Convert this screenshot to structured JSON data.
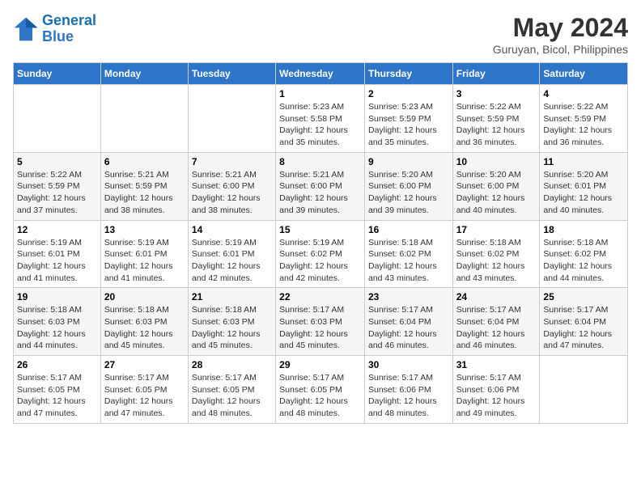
{
  "logo": {
    "line1": "General",
    "line2": "Blue"
  },
  "title": "May 2024",
  "subtitle": "Guruyan, Bicol, Philippines",
  "days_of_week": [
    "Sunday",
    "Monday",
    "Tuesday",
    "Wednesday",
    "Thursday",
    "Friday",
    "Saturday"
  ],
  "weeks": [
    [
      {
        "day": "",
        "sunrise": "",
        "sunset": "",
        "daylight": ""
      },
      {
        "day": "",
        "sunrise": "",
        "sunset": "",
        "daylight": ""
      },
      {
        "day": "",
        "sunrise": "",
        "sunset": "",
        "daylight": ""
      },
      {
        "day": "1",
        "sunrise": "Sunrise: 5:23 AM",
        "sunset": "Sunset: 5:58 PM",
        "daylight": "Daylight: 12 hours and 35 minutes."
      },
      {
        "day": "2",
        "sunrise": "Sunrise: 5:23 AM",
        "sunset": "Sunset: 5:59 PM",
        "daylight": "Daylight: 12 hours and 35 minutes."
      },
      {
        "day": "3",
        "sunrise": "Sunrise: 5:22 AM",
        "sunset": "Sunset: 5:59 PM",
        "daylight": "Daylight: 12 hours and 36 minutes."
      },
      {
        "day": "4",
        "sunrise": "Sunrise: 5:22 AM",
        "sunset": "Sunset: 5:59 PM",
        "daylight": "Daylight: 12 hours and 36 minutes."
      }
    ],
    [
      {
        "day": "5",
        "sunrise": "Sunrise: 5:22 AM",
        "sunset": "Sunset: 5:59 PM",
        "daylight": "Daylight: 12 hours and 37 minutes."
      },
      {
        "day": "6",
        "sunrise": "Sunrise: 5:21 AM",
        "sunset": "Sunset: 5:59 PM",
        "daylight": "Daylight: 12 hours and 38 minutes."
      },
      {
        "day": "7",
        "sunrise": "Sunrise: 5:21 AM",
        "sunset": "Sunset: 6:00 PM",
        "daylight": "Daylight: 12 hours and 38 minutes."
      },
      {
        "day": "8",
        "sunrise": "Sunrise: 5:21 AM",
        "sunset": "Sunset: 6:00 PM",
        "daylight": "Daylight: 12 hours and 39 minutes."
      },
      {
        "day": "9",
        "sunrise": "Sunrise: 5:20 AM",
        "sunset": "Sunset: 6:00 PM",
        "daylight": "Daylight: 12 hours and 39 minutes."
      },
      {
        "day": "10",
        "sunrise": "Sunrise: 5:20 AM",
        "sunset": "Sunset: 6:00 PM",
        "daylight": "Daylight: 12 hours and 40 minutes."
      },
      {
        "day": "11",
        "sunrise": "Sunrise: 5:20 AM",
        "sunset": "Sunset: 6:01 PM",
        "daylight": "Daylight: 12 hours and 40 minutes."
      }
    ],
    [
      {
        "day": "12",
        "sunrise": "Sunrise: 5:19 AM",
        "sunset": "Sunset: 6:01 PM",
        "daylight": "Daylight: 12 hours and 41 minutes."
      },
      {
        "day": "13",
        "sunrise": "Sunrise: 5:19 AM",
        "sunset": "Sunset: 6:01 PM",
        "daylight": "Daylight: 12 hours and 41 minutes."
      },
      {
        "day": "14",
        "sunrise": "Sunrise: 5:19 AM",
        "sunset": "Sunset: 6:01 PM",
        "daylight": "Daylight: 12 hours and 42 minutes."
      },
      {
        "day": "15",
        "sunrise": "Sunrise: 5:19 AM",
        "sunset": "Sunset: 6:02 PM",
        "daylight": "Daylight: 12 hours and 42 minutes."
      },
      {
        "day": "16",
        "sunrise": "Sunrise: 5:18 AM",
        "sunset": "Sunset: 6:02 PM",
        "daylight": "Daylight: 12 hours and 43 minutes."
      },
      {
        "day": "17",
        "sunrise": "Sunrise: 5:18 AM",
        "sunset": "Sunset: 6:02 PM",
        "daylight": "Daylight: 12 hours and 43 minutes."
      },
      {
        "day": "18",
        "sunrise": "Sunrise: 5:18 AM",
        "sunset": "Sunset: 6:02 PM",
        "daylight": "Daylight: 12 hours and 44 minutes."
      }
    ],
    [
      {
        "day": "19",
        "sunrise": "Sunrise: 5:18 AM",
        "sunset": "Sunset: 6:03 PM",
        "daylight": "Daylight: 12 hours and 44 minutes."
      },
      {
        "day": "20",
        "sunrise": "Sunrise: 5:18 AM",
        "sunset": "Sunset: 6:03 PM",
        "daylight": "Daylight: 12 hours and 45 minutes."
      },
      {
        "day": "21",
        "sunrise": "Sunrise: 5:18 AM",
        "sunset": "Sunset: 6:03 PM",
        "daylight": "Daylight: 12 hours and 45 minutes."
      },
      {
        "day": "22",
        "sunrise": "Sunrise: 5:17 AM",
        "sunset": "Sunset: 6:03 PM",
        "daylight": "Daylight: 12 hours and 45 minutes."
      },
      {
        "day": "23",
        "sunrise": "Sunrise: 5:17 AM",
        "sunset": "Sunset: 6:04 PM",
        "daylight": "Daylight: 12 hours and 46 minutes."
      },
      {
        "day": "24",
        "sunrise": "Sunrise: 5:17 AM",
        "sunset": "Sunset: 6:04 PM",
        "daylight": "Daylight: 12 hours and 46 minutes."
      },
      {
        "day": "25",
        "sunrise": "Sunrise: 5:17 AM",
        "sunset": "Sunset: 6:04 PM",
        "daylight": "Daylight: 12 hours and 47 minutes."
      }
    ],
    [
      {
        "day": "26",
        "sunrise": "Sunrise: 5:17 AM",
        "sunset": "Sunset: 6:05 PM",
        "daylight": "Daylight: 12 hours and 47 minutes."
      },
      {
        "day": "27",
        "sunrise": "Sunrise: 5:17 AM",
        "sunset": "Sunset: 6:05 PM",
        "daylight": "Daylight: 12 hours and 47 minutes."
      },
      {
        "day": "28",
        "sunrise": "Sunrise: 5:17 AM",
        "sunset": "Sunset: 6:05 PM",
        "daylight": "Daylight: 12 hours and 48 minutes."
      },
      {
        "day": "29",
        "sunrise": "Sunrise: 5:17 AM",
        "sunset": "Sunset: 6:05 PM",
        "daylight": "Daylight: 12 hours and 48 minutes."
      },
      {
        "day": "30",
        "sunrise": "Sunrise: 5:17 AM",
        "sunset": "Sunset: 6:06 PM",
        "daylight": "Daylight: 12 hours and 48 minutes."
      },
      {
        "day": "31",
        "sunrise": "Sunrise: 5:17 AM",
        "sunset": "Sunset: 6:06 PM",
        "daylight": "Daylight: 12 hours and 49 minutes."
      },
      {
        "day": "",
        "sunrise": "",
        "sunset": "",
        "daylight": ""
      }
    ]
  ]
}
